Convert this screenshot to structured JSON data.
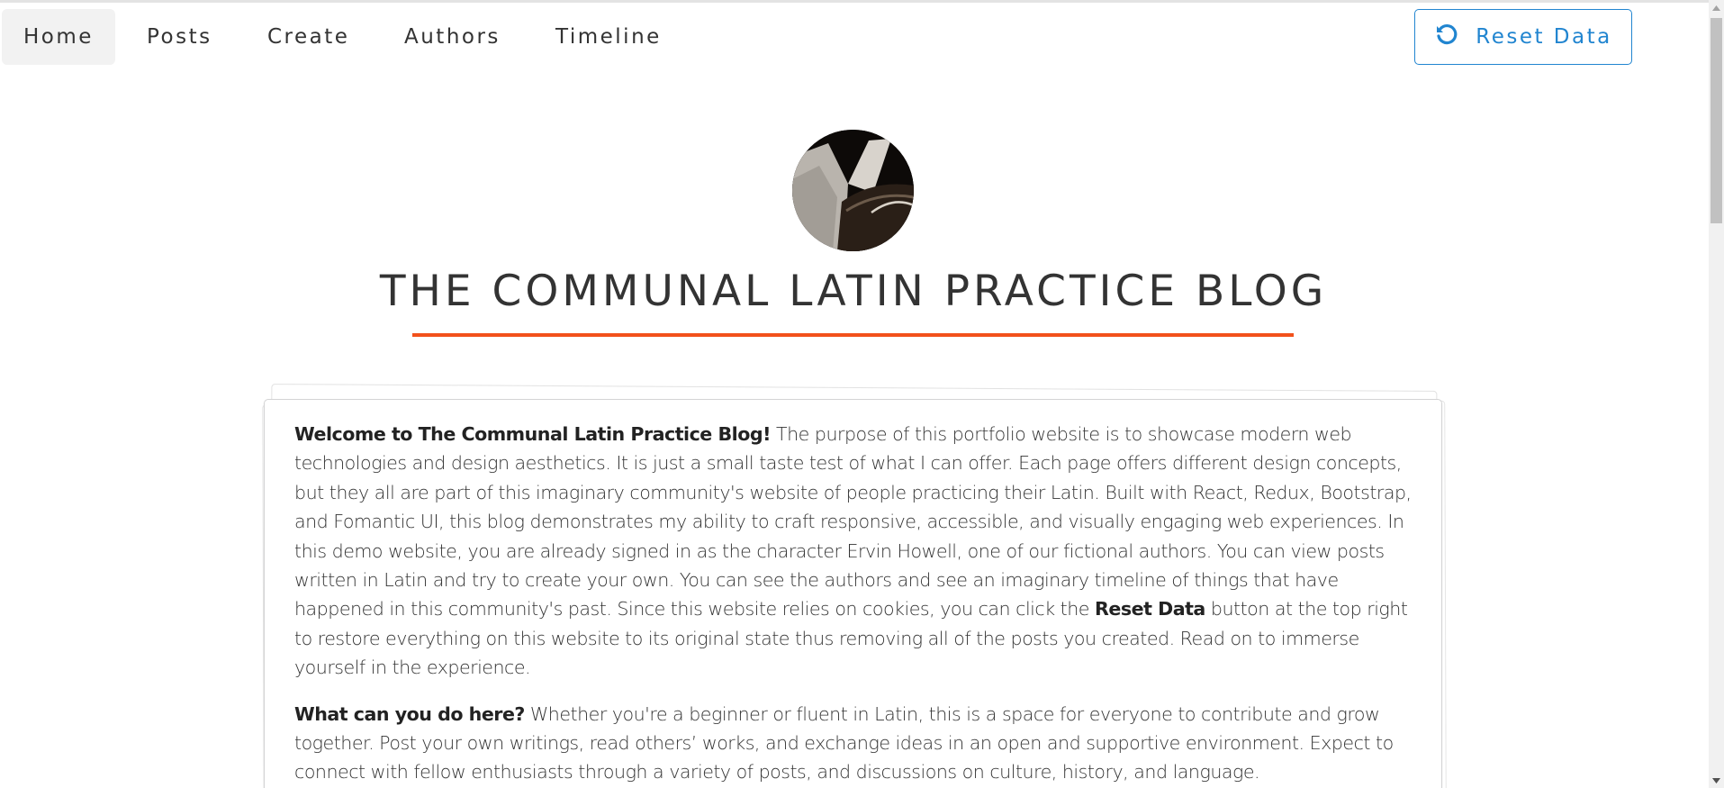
{
  "nav": {
    "items": [
      {
        "label": "Home",
        "active": true
      },
      {
        "label": "Posts",
        "active": false
      },
      {
        "label": "Create",
        "active": false
      },
      {
        "label": "Authors",
        "active": false
      },
      {
        "label": "Timeline",
        "active": false
      }
    ],
    "reset_label": "Reset Data",
    "reset_icon": "undo-icon"
  },
  "header": {
    "title": "THE COMMUNAL LATIN PRACTICE BLOG"
  },
  "intro": {
    "p1_strong": "Welcome to The Communal Latin Practice Blog!",
    "p1_text_a": " The purpose of this portfolio website is to showcase modern web technologies and design aesthetics. It is just a small taste test of what I can offer. Each page offers different design concepts, but they all are part of this imaginary community's website of people practicing their Latin. Built with React, Redux, Bootstrap, and Fomantic UI, this blog demonstrates my ability to craft responsive, accessible, and visually engaging web experiences. In this demo website, you are already signed in as the character Ervin Howell, one of our fictional authors. You can view posts written in Latin and try to create your own. You can see the authors and see an imaginary timeline of things that have happened in this community's past. Since this website relies on cookies, you can click the ",
    "p1_strong2": "Reset Data",
    "p1_text_b": " button at the top right to restore everything on this website to its original state thus removing all of the posts you created. Read on to immerse yourself in the experience.",
    "p2_strong": "What can you do here?",
    "p2_text": " Whether you're a beginner or fluent in Latin, this is a space for everyone to contribute and grow together. Post your own writings, read others’ works, and exchange ideas in an open and supportive environment. Expect to connect with fellow enthusiasts through a variety of posts, and discussions on culture, history, and language."
  },
  "colors": {
    "accent_blue": "#2185d0",
    "underline_orange": "#f2511b"
  }
}
